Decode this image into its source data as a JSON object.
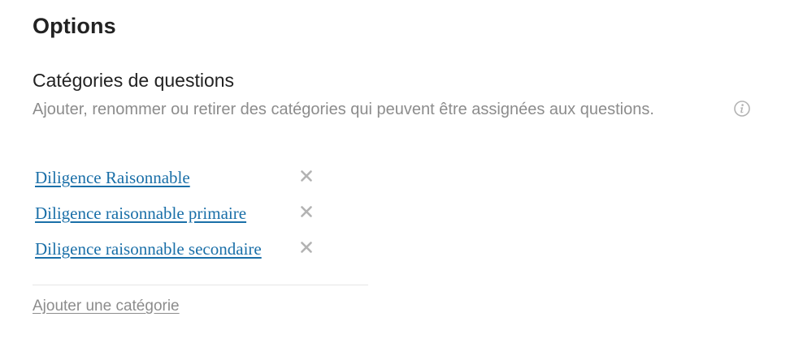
{
  "page": {
    "title": "Options"
  },
  "section": {
    "title": "Catégories de questions",
    "description": "Ajouter, renommer ou retirer des catégories qui peuvent être assignées aux questions.",
    "info_icon": "info-icon"
  },
  "categories": [
    {
      "label": "Diligence Raisonnable",
      "remove_icon": "close-icon"
    },
    {
      "label": "Diligence raisonnable primaire",
      "remove_icon": "close-icon"
    },
    {
      "label": "Diligence raisonnable secondaire",
      "remove_icon": "close-icon"
    }
  ],
  "actions": {
    "add_category_label": "Ajouter une catégorie"
  },
  "colors": {
    "link": "#1a6fa8",
    "muted": "#8c8c8c",
    "text": "#222222",
    "icon": "#b3b3b3"
  }
}
